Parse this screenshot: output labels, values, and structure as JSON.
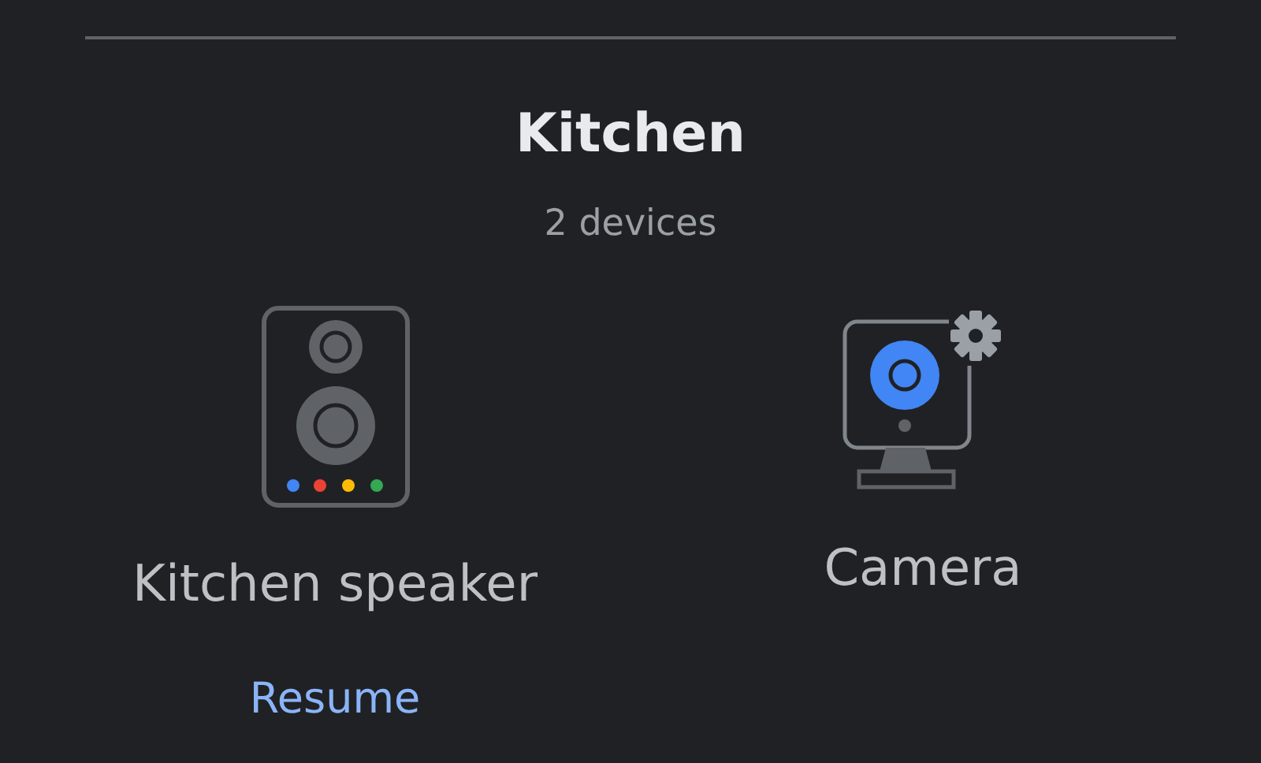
{
  "room": {
    "name": "Kitchen",
    "device_count": "2 devices"
  },
  "devices": [
    {
      "kind": "speaker",
      "name": "Kitchen speaker",
      "action": "Resume"
    },
    {
      "kind": "camera",
      "name": "Camera"
    }
  ]
}
